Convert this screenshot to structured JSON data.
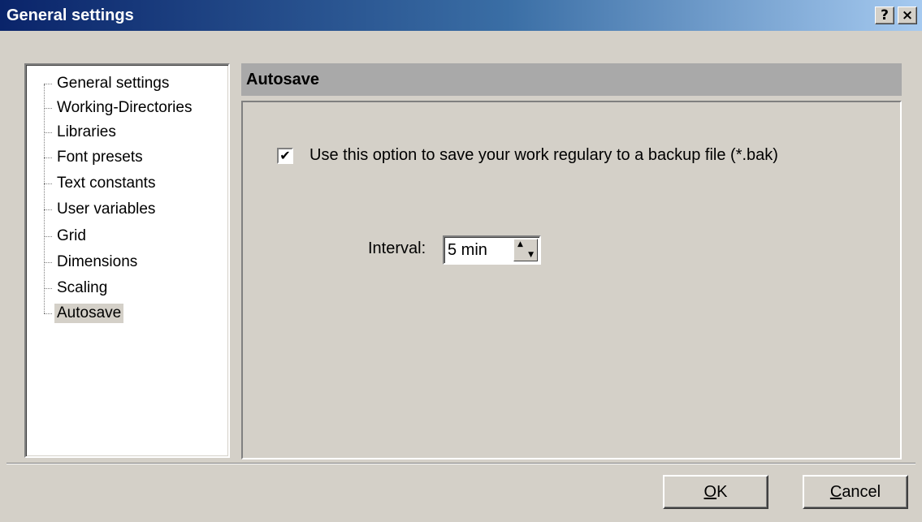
{
  "window": {
    "title": "General settings",
    "help_label": "?",
    "close_label": "×"
  },
  "tree": {
    "items": [
      {
        "label": "General settings",
        "selected": false
      },
      {
        "label": "Working-Directories",
        "selected": false
      },
      {
        "label": "Libraries",
        "selected": false
      },
      {
        "label": "Font presets",
        "selected": false
      },
      {
        "label": "Text constants",
        "selected": false
      },
      {
        "label": "User variables",
        "selected": false
      },
      {
        "label": "Grid",
        "selected": false
      },
      {
        "label": "Dimensions",
        "selected": false
      },
      {
        "label": "Scaling",
        "selected": false
      },
      {
        "label": "Autosave",
        "selected": true
      }
    ]
  },
  "panel": {
    "header": "Autosave",
    "checkbox": {
      "checked": true,
      "mark": "✔",
      "label": "Use this option to save your work regulary to a backup file (*.bak)"
    },
    "interval": {
      "label": "Interval:",
      "value": "5 min"
    }
  },
  "buttons": {
    "ok": {
      "accel": "O",
      "rest": "K"
    },
    "cancel": {
      "accel": "C",
      "rest": "ancel"
    }
  },
  "colors": {
    "title_start": "#0a246a",
    "title_end": "#a6caf0",
    "face": "#d4d0c8",
    "header": "#a9a9a9"
  }
}
